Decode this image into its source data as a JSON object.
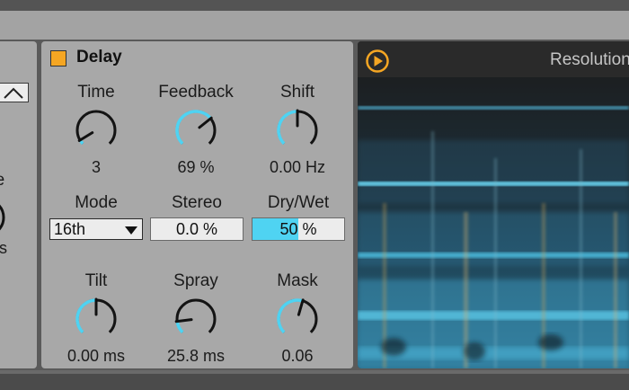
{
  "left_device": {
    "label_fragment": "de",
    "value_fragment": "ms"
  },
  "delay": {
    "title": "Delay",
    "toggle_color": "#f5a623",
    "accent": "#4fd3f2",
    "knobs": {
      "time": {
        "label": "Time",
        "value": "3",
        "level": 0.05
      },
      "feedback": {
        "label": "Feedback",
        "value": "69 %",
        "level": 0.69
      },
      "shift": {
        "label": "Shift",
        "value": "0.00 Hz",
        "level": 0.5
      },
      "tilt": {
        "label": "Tilt",
        "value": "0.00 ms",
        "level": 0.5
      },
      "spray": {
        "label": "Spray",
        "value": "25.8 ms",
        "level": 0.14
      },
      "mask": {
        "label": "Mask",
        "value": "0.06",
        "level": 0.56
      }
    },
    "mode": {
      "label": "Mode",
      "value": "16th"
    },
    "stereo": {
      "label": "Stereo",
      "value": "0.0 %"
    },
    "dry_wet": {
      "label": "Dry/Wet",
      "value": "50 %",
      "level": 0.5
    }
  },
  "spectral": {
    "title": "Resolution",
    "play_color": "#f5a623"
  }
}
